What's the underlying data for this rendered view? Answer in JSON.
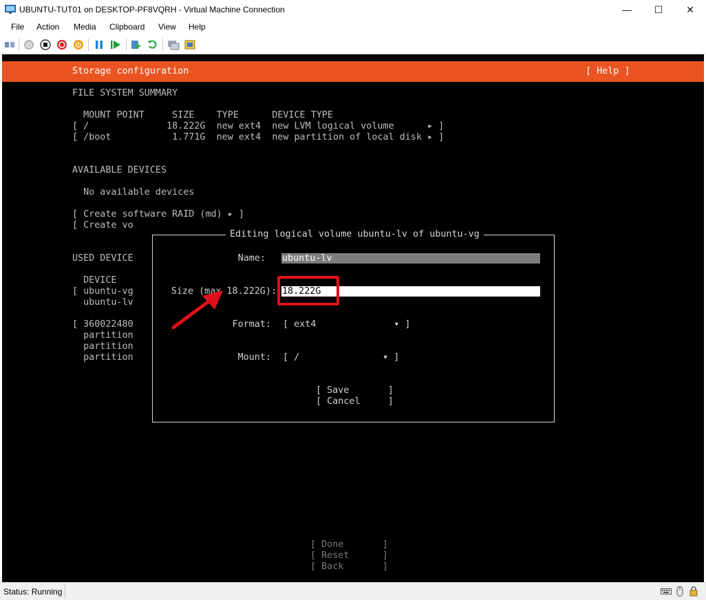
{
  "window": {
    "title": "UBUNTU-TUT01 on DESKTOP-PF8VQRH - Virtual Machine Connection",
    "minimize_glyph": "—",
    "maximize_glyph": "☐",
    "close_glyph": "✕"
  },
  "menu": [
    "File",
    "Action",
    "Media",
    "Clipboard",
    "View",
    "Help"
  ],
  "toolbar": {
    "icons": [
      "ctrl-alt-del-icon",
      "start-icon",
      "turn-off-icon",
      "shutdown-icon",
      "save-state-icon",
      "pause-icon",
      "resume-icon",
      "checkpoint-icon",
      "revert-icon",
      "enhanced-session-icon",
      "zoom-icon"
    ]
  },
  "installer": {
    "header_title": "Storage configuration",
    "help": "[ Help ]",
    "fs_summary_heading": "FILE SYSTEM SUMMARY",
    "fs_columns": "  MOUNT POINT     SIZE    TYPE      DEVICE TYPE",
    "fs_rows": [
      "[ /              18.222G  new ext4  new LVM logical volume      ▸ ]",
      "[ /boot           1.771G  new ext4  new partition of local disk ▸ ]"
    ],
    "available_heading": "AVAILABLE DEVICES",
    "no_devices": "  No available devices",
    "create_raid": "[ Create software RAID (md) ▸ ]",
    "create_vo": "[ Create vo",
    "used_heading": "USED DEVICE",
    "used_lines": [
      "  DEVICE",
      "[ ubuntu-vg",
      "  ubuntu-lv",
      "",
      "[ 360022480",
      "  partition",
      "  partition",
      "  partition"
    ],
    "footer_buttons": [
      "[ Done       ]",
      "[ Reset      ]",
      "[ Back       ]"
    ]
  },
  "dialog": {
    "title": "Editing logical volume ubuntu-lv of ubuntu-vg",
    "name_label": "Name:",
    "name_value": "ubuntu-lv",
    "size_label": "Size (max 18.222G):",
    "size_value": "18.222G",
    "format_label": "Format:",
    "format_value": "[ ext4              ▾ ]",
    "mount_label": "Mount:",
    "mount_value": "[ /               ▾ ]",
    "save_button": "[ Save       ]",
    "cancel_button": "[ Cancel     ]"
  },
  "annotation": {
    "highlight_color": "#e0101a"
  },
  "status": {
    "text": "Status: Running"
  },
  "colors": {
    "ubuntu_orange": "#e95420"
  }
}
